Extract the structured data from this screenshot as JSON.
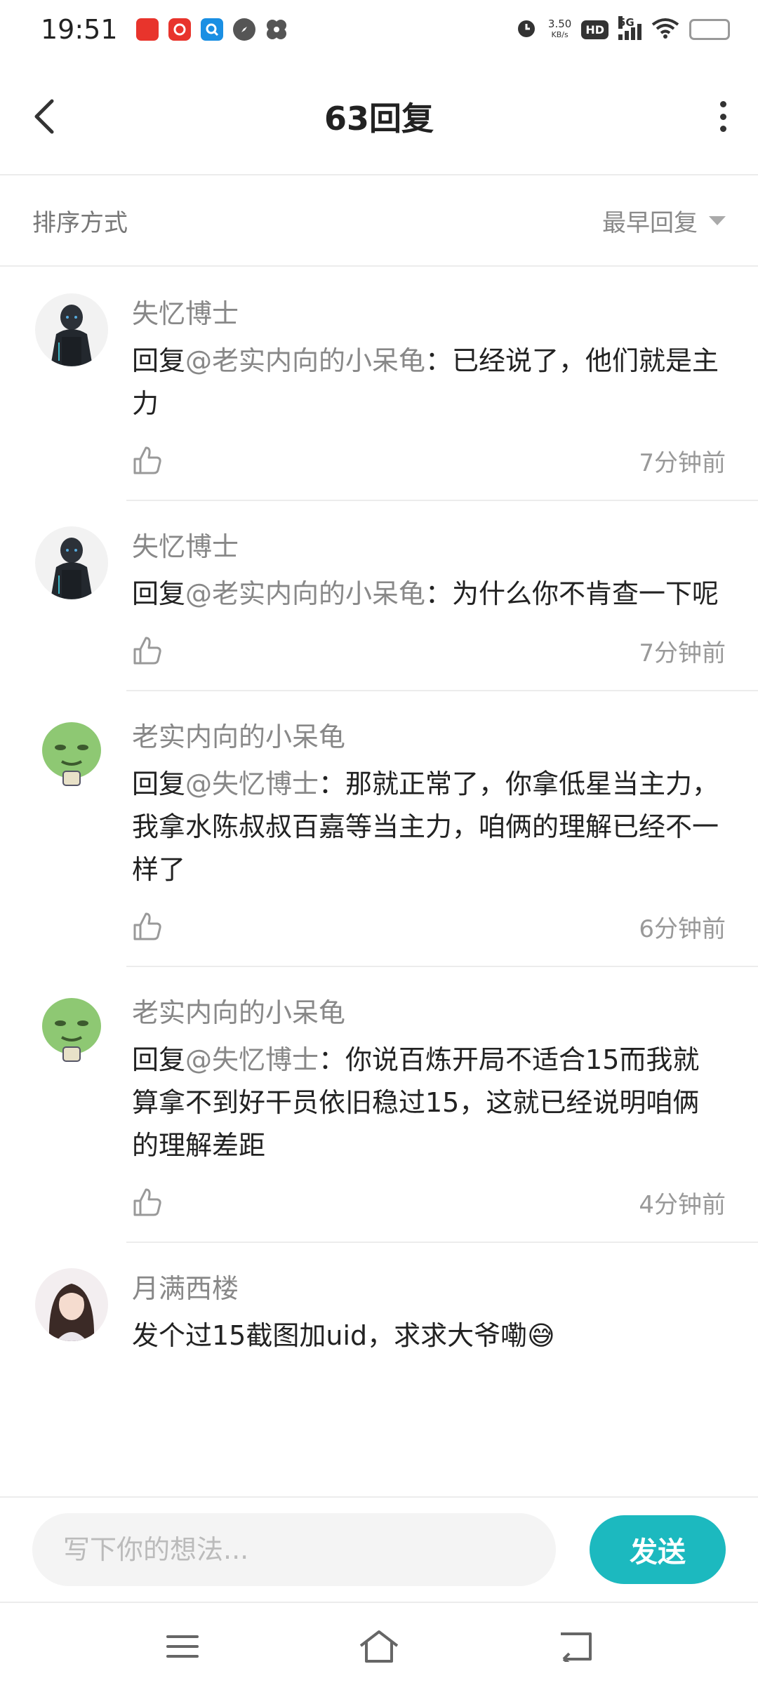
{
  "status": {
    "time": "19:51",
    "net_speed_value": "3.50",
    "net_speed_unit": "KB/s",
    "hd": "HD",
    "network": "5G",
    "battery": "11",
    "app_icons": [
      "qidian-app-icon",
      "netease-music-app-icon",
      "browser-app-icon",
      "compass-app-icon",
      "pinwheel-app-icon"
    ]
  },
  "header": {
    "title": "63回复"
  },
  "sort": {
    "label": "排序方式",
    "selected": "最早回复"
  },
  "replies": [
    {
      "name": "失忆博士",
      "prefix": "回复",
      "mention": "@老实内向的小呆龟",
      "text": "：已经说了，他们就是主力",
      "time": "7分钟前",
      "avatar": "dark-figure"
    },
    {
      "name": "失忆博士",
      "prefix": "回复",
      "mention": "@老实内向的小呆龟",
      "text": "：为什么你不肯查一下呢",
      "time": "7分钟前",
      "avatar": "dark-figure"
    },
    {
      "name": "老实内向的小呆龟",
      "prefix": "回复",
      "mention": "@失忆博士",
      "text": "：那就正常了，你拿低星当主力，我拿水陈叔叔百嘉等当主力，咱俩的理解已经不一样了",
      "time": "6分钟前",
      "avatar": "green-face"
    },
    {
      "name": "老实内向的小呆龟",
      "prefix": "回复",
      "mention": "@失忆博士",
      "text": "：你说百炼开局不适合15而我就算拿不到好干员依旧稳过15，这就已经说明咱俩的理解差距",
      "time": "4分钟前",
      "avatar": "green-face"
    },
    {
      "name": "月满西楼",
      "prefix": "",
      "mention": "",
      "text": "发个过15截图加uid，求求大爷嘞😅",
      "time": "",
      "avatar": "anime-girl"
    }
  ],
  "compose": {
    "placeholder": "写下你的想法...",
    "send_label": "发送"
  },
  "colors": {
    "accent": "#1cb9bf",
    "muted_text": "#888888",
    "divider": "#ececec"
  }
}
